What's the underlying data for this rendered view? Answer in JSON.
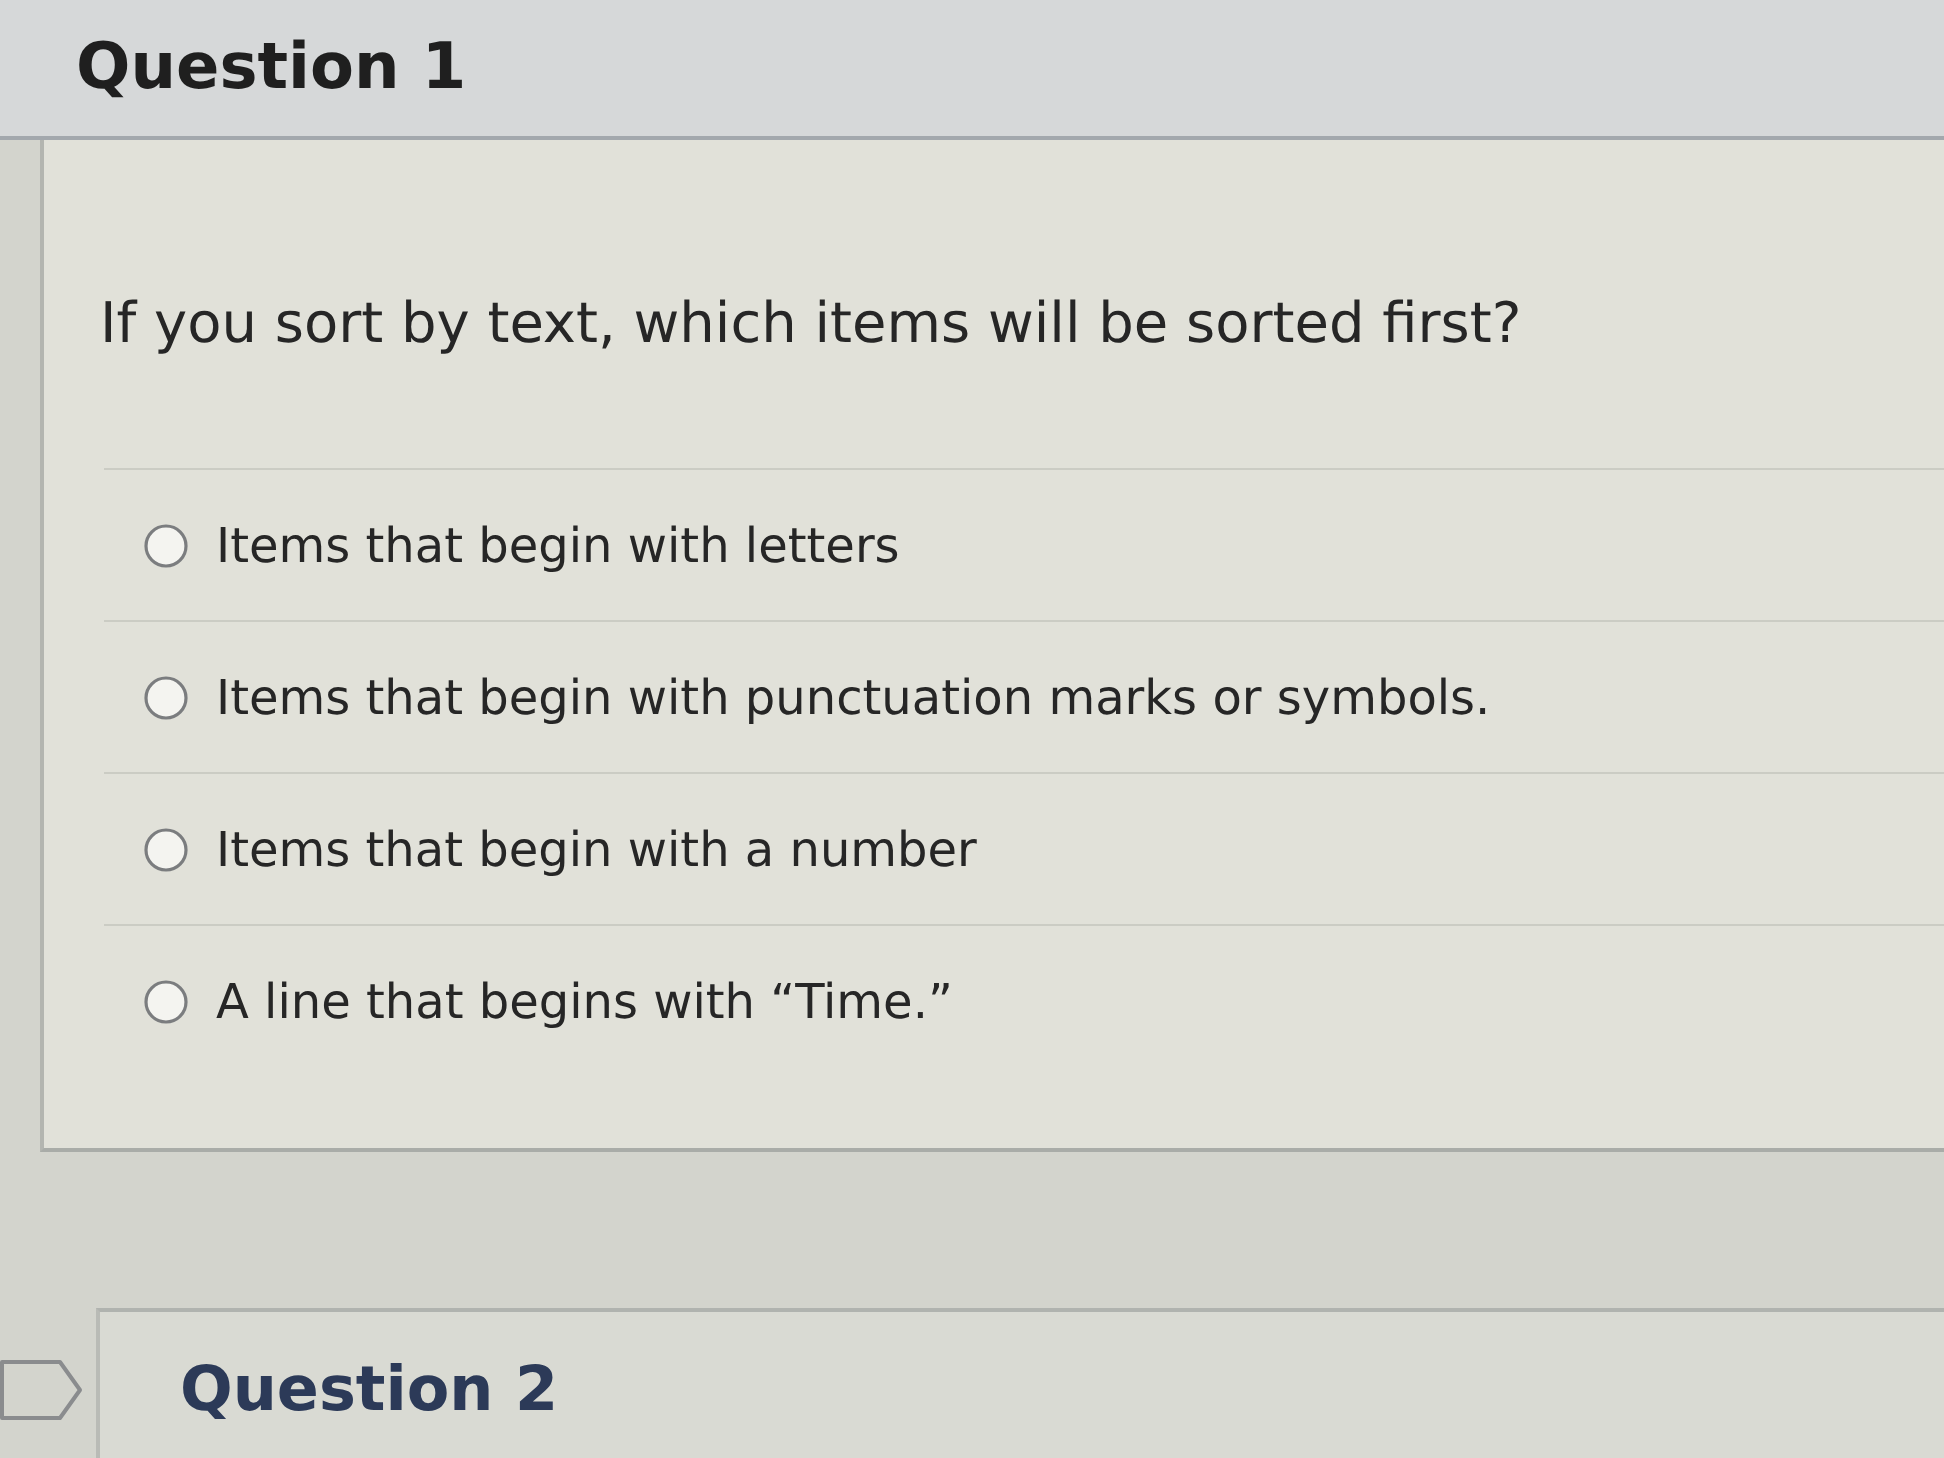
{
  "questions": [
    {
      "title": "Question 1",
      "prompt": "If you sort by text, which items will be sorted first?",
      "answers": [
        {
          "text": "Items that begin with letters",
          "selected": false
        },
        {
          "text": "Items that begin with punctuation marks or symbols.",
          "selected": false
        },
        {
          "text": "Items that begin with a number",
          "selected": false
        },
        {
          "text": "A line that begins with “Time.”",
          "selected": false
        }
      ]
    },
    {
      "title": "Question 2",
      "flagged": false
    }
  ]
}
